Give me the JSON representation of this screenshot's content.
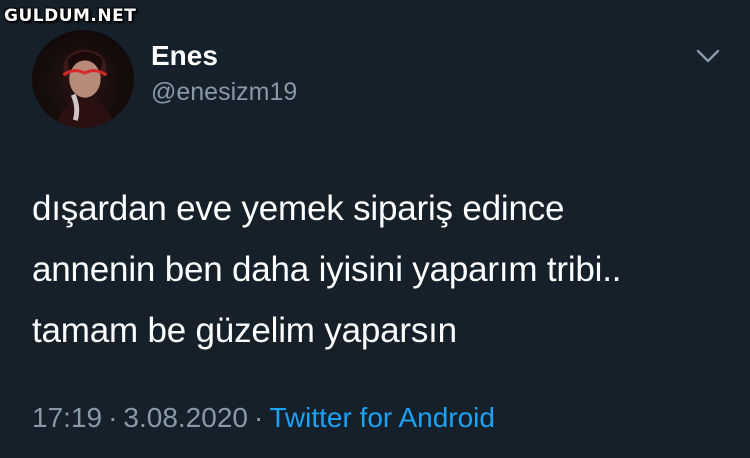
{
  "watermark": "GULDUM.NET",
  "user": {
    "display_name": "Enes",
    "handle": "@enesizm19",
    "avatar_icon": "user-avatar-photo"
  },
  "tweet": {
    "lines": [
      "dışardan eve yemek sipariş edince",
      "annenin ben daha iyisini yaparım tribi..",
      "tamam be güzelim yaparsın"
    ]
  },
  "meta": {
    "time": "17:19",
    "separator": "·",
    "date": "3.08.2020",
    "source": "Twitter for Android"
  },
  "colors": {
    "background": "#15202b",
    "text": "#ffffff",
    "secondary": "#8899a6",
    "link": "#1da1f2"
  },
  "icons": {
    "menu": "chevron-down-icon"
  }
}
